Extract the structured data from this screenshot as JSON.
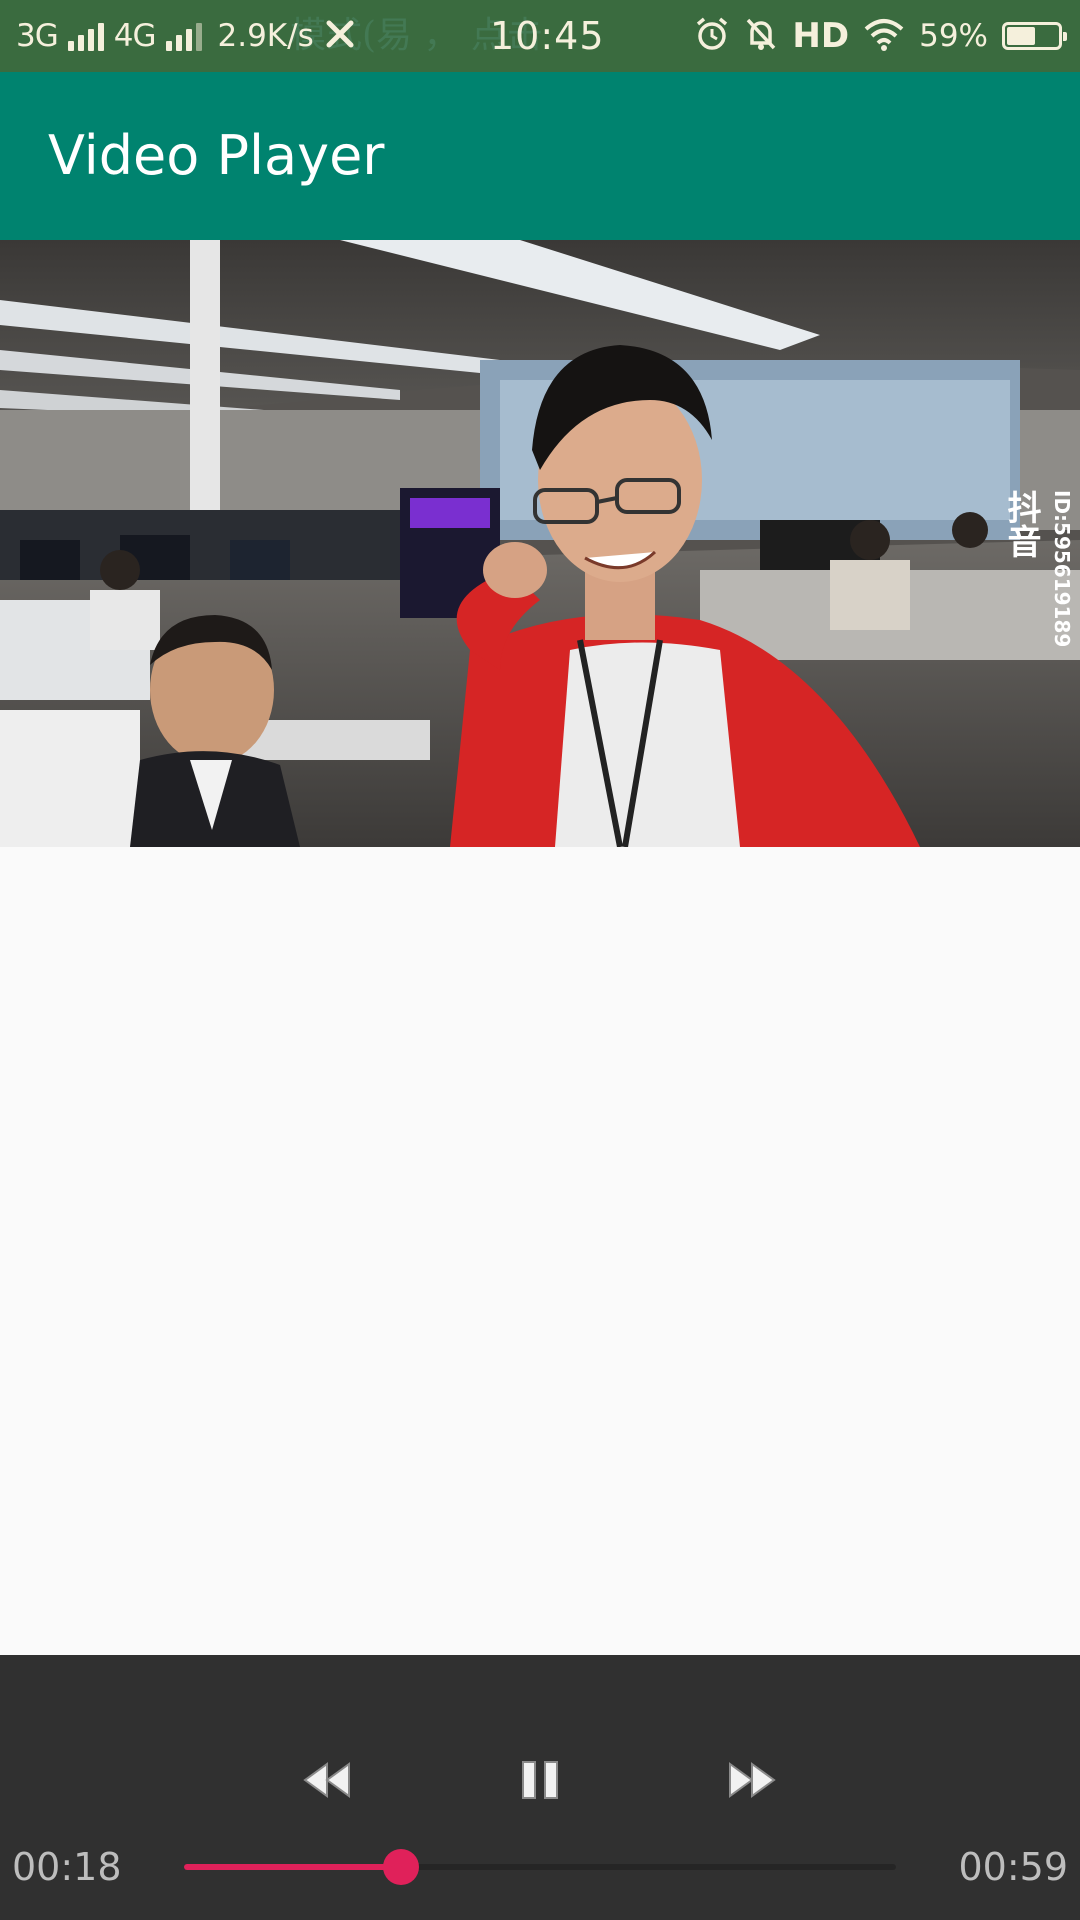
{
  "status_bar": {
    "network_1": "3G",
    "network_2": "4G",
    "speed": "2.9K/s",
    "clock": "10:45",
    "faint_text": "模式(易 ， 点击",
    "hd": "HD",
    "battery_text": "59%",
    "battery_level": 0.59,
    "icons": [
      "signal-icon",
      "tools-icon",
      "alarm-icon",
      "notifications-off-icon",
      "wifi-icon",
      "battery-icon"
    ]
  },
  "app_bar": {
    "title": "Video Player",
    "color": "#00836f"
  },
  "video": {
    "watermark_logo": "抖音",
    "watermark_id": "ID:595619189"
  },
  "controls": {
    "rewind_icon": "rewind-icon",
    "pause_icon": "pause-icon",
    "forward_icon": "fast-forward-icon",
    "elapsed": "00:18",
    "duration": "00:59",
    "progress": 0.305,
    "accent_color": "#e0215a"
  }
}
